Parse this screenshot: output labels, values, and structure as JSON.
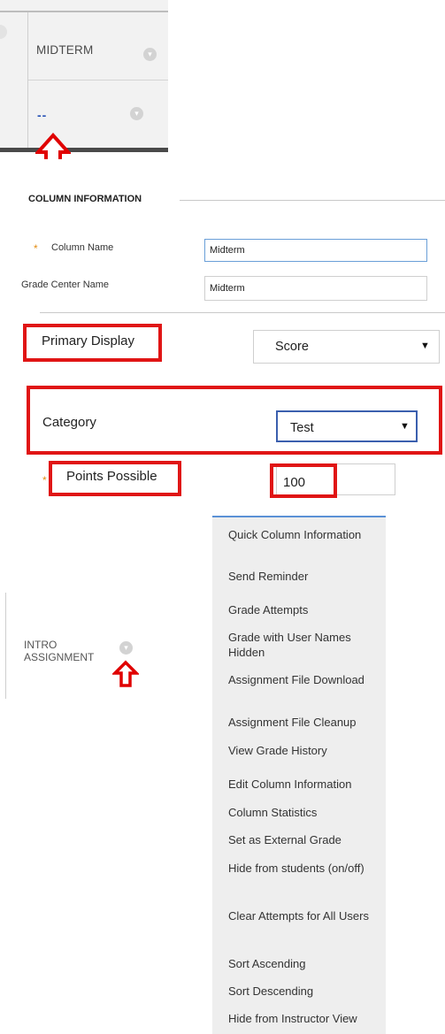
{
  "grade_center": {
    "column1_title": "MIDTERM",
    "column2_value": "--"
  },
  "column_information": {
    "section_title": "COLUMN INFORMATION",
    "column_name_label": "Column Name",
    "column_name_value": "Midterm",
    "grade_center_name_label": "Grade Center Name",
    "grade_center_name_value": "Midterm",
    "required_marker": "*",
    "primary_display_label": "Primary Display",
    "primary_display_value": "Score",
    "category_label": "Category",
    "category_value": "Test",
    "points_possible_label": "Points Possible",
    "points_possible_value": "100",
    "dropdown_glyph": "▼"
  },
  "assignment_column": {
    "title_line1": "INTRO",
    "title_line2": "ASSIGNMENT"
  },
  "context_menu": {
    "items": [
      "Quick Column Information",
      "Send Reminder",
      "Grade Attempts",
      "Grade with User Names Hidden",
      "Assignment File Download",
      "Assignment File Cleanup",
      "View Grade History",
      "Edit Column Information",
      "Column Statistics",
      "Set as External Grade",
      "Hide from students (on/off)",
      "Clear Attempts for All Users",
      "Sort Ascending",
      "Sort Descending",
      "Hide from Instructor View"
    ]
  },
  "colors": {
    "annotation_red": "#e00000",
    "link_blue": "#2b55b6",
    "required_orange": "#e38d13",
    "menu_accent": "#5b91d6"
  },
  "icons": {
    "column_menu": "chevron-down-icon",
    "annotation_arrow": "red-up-arrow-icon"
  }
}
